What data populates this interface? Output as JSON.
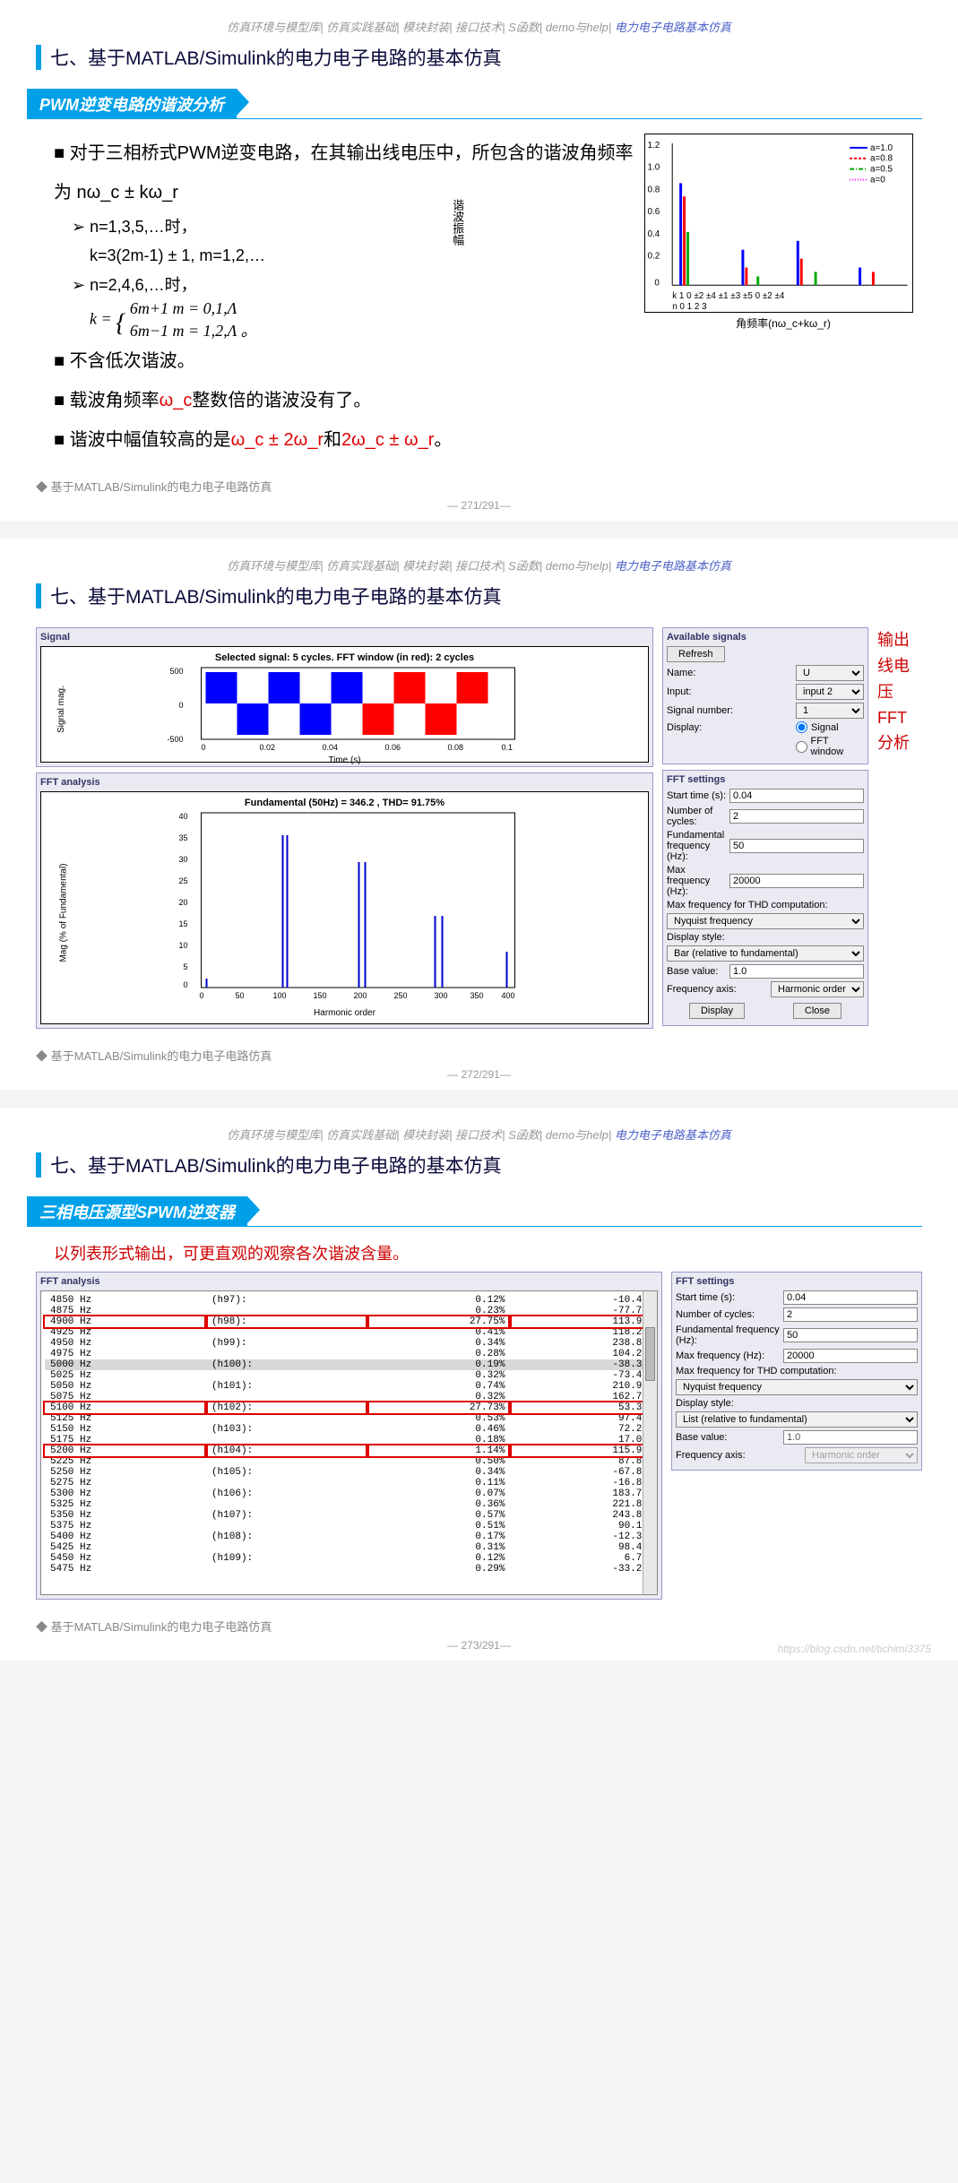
{
  "nav_grey": "仿真环境与模型库| 仿真实践基础| 模块封装| 接口技术| S函数| demo与help|",
  "nav_blue": "电力电子电路基本仿真",
  "section_title": "七、基于MATLAB/Simulink的电力电子电路的基本仿真",
  "footer_text": "基于MATLAB/Simulink的电力电子电路仿真",
  "page_271": "— 271/291—",
  "page_272": "— 272/291—",
  "page_273": "— 273/291—",
  "watermark": "https://blog.csdn.net/tichimi3375",
  "slide1": {
    "banner": "PWM逆变电路的谐波分析",
    "main_bullet": "对于三相桥式PWM逆变电路，在其输出线电压中，所包含的谐波角频率为  nω_c ± kω_r",
    "sub1_a": "n=1,3,5,…时，",
    "sub1_b": "k=3(2m-1) ± 1,  m=1,2,…",
    "sub2_a": "n=2,4,6,…时，",
    "formula_top": "6m+1   m = 0,1,Λ",
    "formula_bot": "6m−1   m = 1,2,Λ 。",
    "b2": "不含低次谐波。",
    "b3_a": "载波角频率",
    "b3_red": "ω_c",
    "b3_b": "整数倍的谐波没有了。",
    "b4_a": "谐波中幅值较高的是",
    "b4_r1": "ω_c ± 2ω_r",
    "b4_mid": "和",
    "b4_r2": "2ω_c ± ω_r",
    "b4_end": "。",
    "chart_ylabel": "谐波振幅",
    "chart_xlabel": "角频率(nω_c+kω_r)",
    "legend": [
      "a=1.0",
      "a=0.8",
      "a=0.5",
      "a=0"
    ]
  },
  "slide2": {
    "signal_box": "Signal",
    "signal_title": "Selected signal: 5 cycles. FFT window (in red): 2 cycles",
    "x_label": "Time (s)",
    "y_label": "Signal mag.",
    "y_ticks": [
      "500",
      "0",
      "-500"
    ],
    "x_ticks": [
      "0",
      "0.02",
      "0.04",
      "0.06",
      "0.08",
      "0.1"
    ],
    "fft_box": "FFT analysis",
    "fft_title": "Fundamental (50Hz) = 346.2 , THD= 91.75%",
    "fft_y": "Mag (% of Fundamental)",
    "fft_x": "Harmonic order",
    "fft_yticks": [
      "40",
      "35",
      "30",
      "25",
      "20",
      "15",
      "10",
      "5",
      "0"
    ],
    "fft_xticks": [
      "0",
      "50",
      "100",
      "150",
      "200",
      "250",
      "300",
      "350",
      "400"
    ],
    "avail_title": "Available signals",
    "refresh": "Refresh",
    "name_lbl": "Name:",
    "name_val": "U",
    "input_lbl": "Input:",
    "input_val": "input 2",
    "signum_lbl": "Signal number:",
    "signum_val": "1",
    "display_lbl": "Display:",
    "disp_opt1": "Signal",
    "disp_opt2": "FFT window",
    "fftset_title": "FFT settings",
    "st_lbl": "Start time (s):",
    "st_val": "0.04",
    "nc_lbl": "Number of cycles:",
    "nc_val": "2",
    "ff_lbl": "Fundamental frequency (Hz):",
    "ff_val": "50",
    "mf_lbl": "Max frequency (Hz):",
    "mf_val": "20000",
    "mthd_lbl": "Max frequency for THD computation:",
    "mthd_val": "Nyquist frequency",
    "ds_lbl": "Display style:",
    "ds_val": "Bar (relative to fundamental)",
    "bv_lbl": "Base value:",
    "bv_val": "1.0",
    "fa_lbl": "Frequency axis:",
    "fa_val": "Harmonic order",
    "btn_display": "Display",
    "btn_close": "Close",
    "annot": "输出\n线电\n压\nFFT\n分析"
  },
  "slide3": {
    "banner": "三相电压源型SPWM逆变器",
    "intro": "以列表形式输出，可更直观的观察各次谐波含量。",
    "fft_box": "FFT analysis",
    "table": [
      {
        "hz": "4850 Hz",
        "ord": "(h97):",
        "mag": "0.12%",
        "ph": "-10.4°"
      },
      {
        "hz": "4875 Hz",
        "ord": "",
        "mag": "0.23%",
        "ph": "-77.7°"
      },
      {
        "hz": "4900 Hz",
        "ord": "(h98):",
        "mag": "27.75%",
        "ph": "113.9°",
        "hl": true
      },
      {
        "hz": "4925 Hz",
        "ord": "",
        "mag": "0.41%",
        "ph": "118.2°"
      },
      {
        "hz": "4950 Hz",
        "ord": "(h99):",
        "mag": "0.34%",
        "ph": "238.8°"
      },
      {
        "hz": "4975 Hz",
        "ord": "",
        "mag": "0.28%",
        "ph": "104.2°"
      },
      {
        "hz": "5000 Hz",
        "ord": "(h100):",
        "mag": "0.19%",
        "ph": "-38.3°",
        "shade": true
      },
      {
        "hz": "5025 Hz",
        "ord": "",
        "mag": "0.32%",
        "ph": "-73.4°"
      },
      {
        "hz": "5050 Hz",
        "ord": "(h101):",
        "mag": "0.74%",
        "ph": "210.9°"
      },
      {
        "hz": "5075 Hz",
        "ord": "",
        "mag": "0.32%",
        "ph": "162.7°"
      },
      {
        "hz": "5100 Hz",
        "ord": "(h102):",
        "mag": "27.73%",
        "ph": "53.3°",
        "hl": true
      },
      {
        "hz": "5125 Hz",
        "ord": "",
        "mag": "0.53%",
        "ph": "97.4°"
      },
      {
        "hz": "5150 Hz",
        "ord": "(h103):",
        "mag": "0.46%",
        "ph": "72.2°"
      },
      {
        "hz": "5175 Hz",
        "ord": "",
        "mag": "0.18%",
        "ph": "17.0°"
      },
      {
        "hz": "5200 Hz",
        "ord": "(h104):",
        "mag": "1.14%",
        "ph": "115.9°",
        "hl": true
      },
      {
        "hz": "5225 Hz",
        "ord": "",
        "mag": "0.50%",
        "ph": "87.8°"
      },
      {
        "hz": "5250 Hz",
        "ord": "(h105):",
        "mag": "0.34%",
        "ph": "-67.8°"
      },
      {
        "hz": "5275 Hz",
        "ord": "",
        "mag": "0.11%",
        "ph": "-16.8°"
      },
      {
        "hz": "5300 Hz",
        "ord": "(h106):",
        "mag": "0.07%",
        "ph": "183.7°"
      },
      {
        "hz": "5325 Hz",
        "ord": "",
        "mag": "0.36%",
        "ph": "221.8°"
      },
      {
        "hz": "5350 Hz",
        "ord": "(h107):",
        "mag": "0.57%",
        "ph": "243.8°"
      },
      {
        "hz": "5375 Hz",
        "ord": "",
        "mag": "0.51%",
        "ph": "90.1°"
      },
      {
        "hz": "5400 Hz",
        "ord": "(h108):",
        "mag": "0.17%",
        "ph": "-12.3°"
      },
      {
        "hz": "5425 Hz",
        "ord": "",
        "mag": "0.31%",
        "ph": "98.4°"
      },
      {
        "hz": "5450 Hz",
        "ord": "(h109):",
        "mag": "0.12%",
        "ph": "6.7°"
      },
      {
        "hz": "5475 Hz",
        "ord": "",
        "mag": "0.29%",
        "ph": "-33.2°"
      }
    ],
    "fftset_title": "FFT settings",
    "st_lbl": "Start time (s):",
    "st_val": "0.04",
    "nc_lbl": "Number of cycles:",
    "nc_val": "2",
    "ff_lbl": "Fundamental frequency (Hz):",
    "ff_val": "50",
    "mf_lbl": "Max frequency (Hz):",
    "mf_val": "20000",
    "mthd_lbl": "Max frequency for THD computation:",
    "mthd_val": "Nyquist frequency",
    "ds_lbl": "Display style:",
    "ds_val": "List (relative to fundamental)",
    "bv_lbl": "Base value:",
    "bv_val": "1.0",
    "fa_lbl": "Frequency axis:",
    "fa_val": "Harmonic order"
  },
  "chart_data": {
    "type": "bar",
    "ylim": [
      0,
      1.2
    ],
    "y_ticks": [
      0,
      0.2,
      0.4,
      0.6,
      0.8,
      1.0,
      1.2
    ],
    "groups": [
      {
        "n": 0,
        "k": [
          1
        ]
      },
      {
        "n": 1,
        "k": [
          0,
          2,
          4
        ]
      },
      {
        "n": 2,
        "k": [
          1,
          3,
          5
        ]
      },
      {
        "n": 3,
        "k": [
          0,
          2,
          4
        ]
      }
    ],
    "series": [
      {
        "name": "a=1.0",
        "color": "#0000ff"
      },
      {
        "name": "a=0.8",
        "color": "#ff0000"
      },
      {
        "name": "a=0.5",
        "color": "#00aa00"
      },
      {
        "name": "a=0",
        "color": "#ff00ff"
      }
    ],
    "xlabel": "角频率(nω_c+kω_r)",
    "ylabel": "谐波振幅"
  }
}
